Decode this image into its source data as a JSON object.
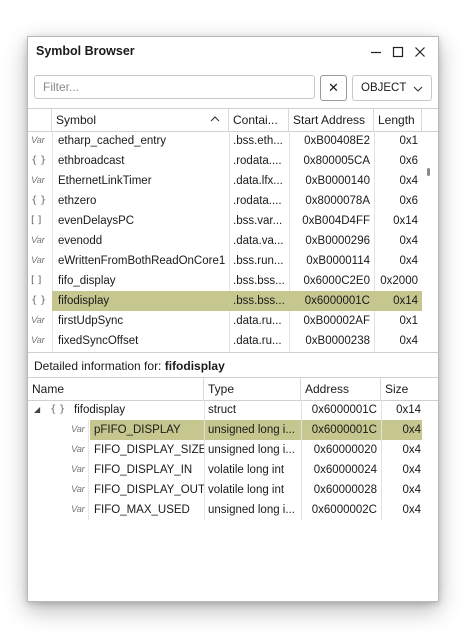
{
  "window": {
    "title": "Symbol Browser"
  },
  "toolbar": {
    "filter_placeholder": "Filter...",
    "filter_value": "",
    "clear_label": "✕",
    "type_select_value": "OBJECT"
  },
  "symbols": {
    "headers": [
      "Symbol",
      "Contai...",
      "Start Address",
      "Length"
    ],
    "rows": [
      {
        "icon": "variable-icon",
        "glyph": "Var",
        "name": "etharp_cached_entry",
        "container": ".bss.eth...",
        "address": "0xB00408E2",
        "length": "0x1"
      },
      {
        "icon": "struct-icon",
        "glyph": "{ }",
        "name": "ethbroadcast",
        "container": ".rodata....",
        "address": "0x800005CA",
        "length": "0x6"
      },
      {
        "icon": "variable-icon",
        "glyph": "Var",
        "name": "EthernetLinkTimer",
        "container": ".data.lfx...",
        "address": "0xB0000140",
        "length": "0x4"
      },
      {
        "icon": "struct-icon",
        "glyph": "{ }",
        "name": "ethzero",
        "container": ".rodata....",
        "address": "0x8000078A",
        "length": "0x6"
      },
      {
        "icon": "array-icon",
        "glyph": "[ ]",
        "name": "evenDelaysPC",
        "container": ".bss.var...",
        "address": "0xB004D4FF",
        "length": "0x14"
      },
      {
        "icon": "variable-icon",
        "glyph": "Var",
        "name": "evenodd",
        "container": ".data.va...",
        "address": "0xB0000296",
        "length": "0x4"
      },
      {
        "icon": "variable-icon",
        "glyph": "Var",
        "name": "eWrittenFromBothReadOnCore1",
        "container": ".bss.run...",
        "address": "0xB0000114",
        "length": "0x4"
      },
      {
        "icon": "array-icon",
        "glyph": "[ ]",
        "name": "fifo_display",
        "container": ".bss.bss...",
        "address": "0x6000C2E0",
        "length": "0x2000"
      },
      {
        "icon": "struct-icon",
        "glyph": "{ }",
        "name": "fifodisplay",
        "container": ".bss.bss...",
        "address": "0x6000001C",
        "length": "0x14",
        "selected": true
      },
      {
        "icon": "variable-icon",
        "glyph": "Var",
        "name": "firstUdpSync",
        "container": ".data.ru...",
        "address": "0xB00002AF",
        "length": "0x1"
      },
      {
        "icon": "variable-icon",
        "glyph": "Var",
        "name": "fixedSyncOffset",
        "container": ".data.ru...",
        "address": "0xB0000238",
        "length": "0x4"
      }
    ]
  },
  "details": {
    "label_prefix": "Detailed information for: ",
    "label_symbol": "fifodisplay",
    "headers": [
      "Name",
      "Type",
      "Address",
      "Size"
    ],
    "root": {
      "glyph": "{ }",
      "expander": "◢",
      "name": "fifodisplay",
      "type": "struct",
      "address": "0x6000001C",
      "size": "0x14"
    },
    "members": [
      {
        "glyph": "Var",
        "name": "pFIFO_DISPLAY",
        "type": "unsigned long i...",
        "address": "0x6000001C",
        "size": "0x4",
        "selected": true
      },
      {
        "glyph": "Var",
        "name": "FIFO_DISPLAY_SIZE",
        "type": "unsigned long i...",
        "address": "0x60000020",
        "size": "0x4"
      },
      {
        "glyph": "Var",
        "name": "FIFO_DISPLAY_IN",
        "type": "volatile long int",
        "address": "0x60000024",
        "size": "0x4"
      },
      {
        "glyph": "Var",
        "name": "FIFO_DISPLAY_OUT",
        "type": "volatile long int",
        "address": "0x60000028",
        "size": "0x4"
      },
      {
        "glyph": "Var",
        "name": "FIFO_MAX_USED",
        "type": "unsigned long i...",
        "address": "0x6000002C",
        "size": "0x4"
      }
    ]
  },
  "colors": {
    "selection": "#c5c78f"
  }
}
